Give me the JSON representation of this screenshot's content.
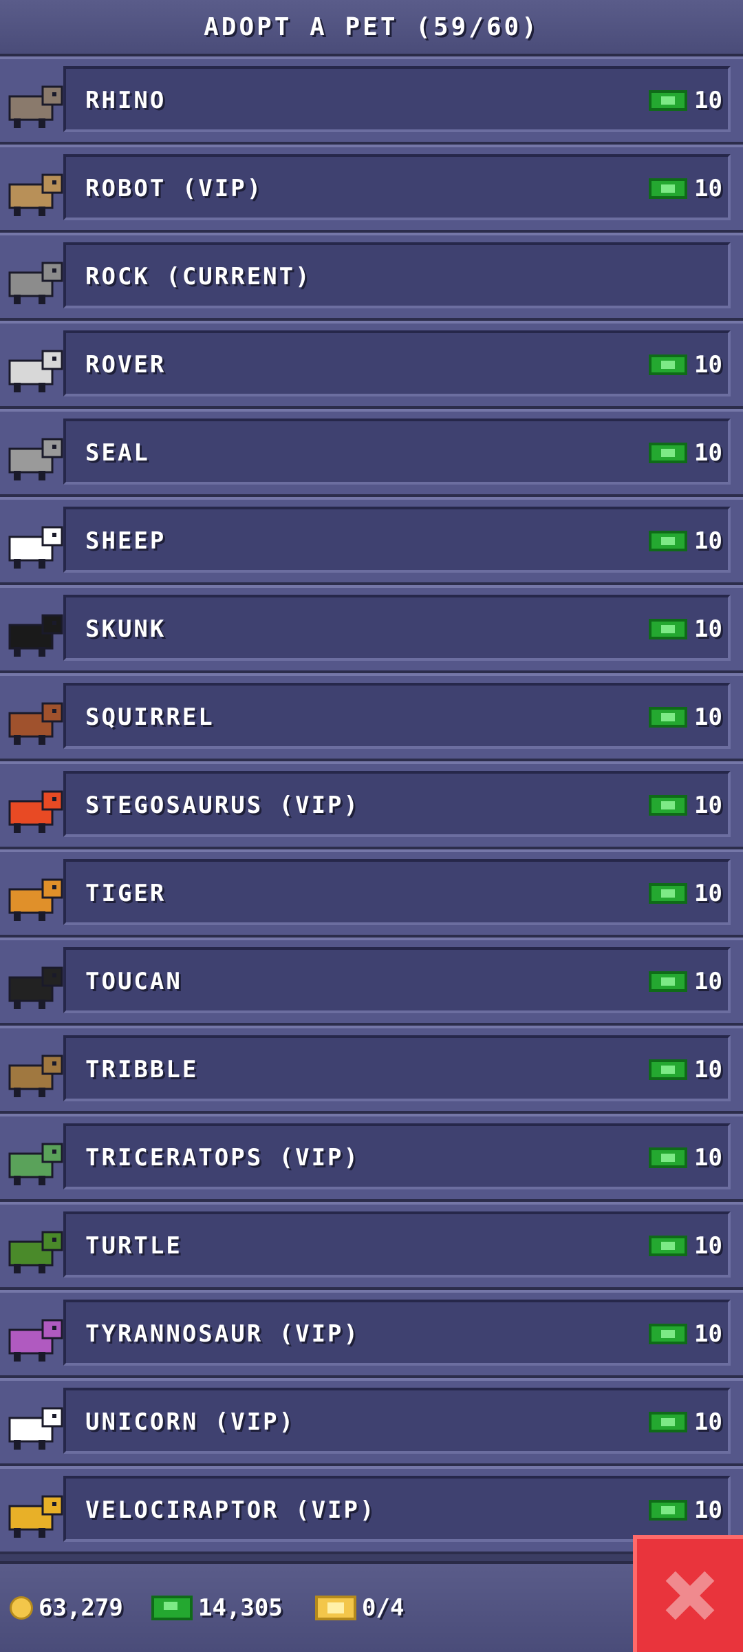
{
  "header": {
    "title": "ADOPT A PET (59/60)"
  },
  "pets": [
    {
      "name": "RHINO",
      "price": "10",
      "icon": "rhino-icon",
      "color": "#8a7a6c"
    },
    {
      "name": "ROBOT (VIP)",
      "price": "10",
      "icon": "robot-icon",
      "color": "#b89058"
    },
    {
      "name": "ROCK (CURRENT)",
      "price": "",
      "icon": "rock-icon",
      "color": "#8c8c8c"
    },
    {
      "name": "ROVER",
      "price": "10",
      "icon": "rover-icon",
      "color": "#d8d8d8"
    },
    {
      "name": "SEAL",
      "price": "10",
      "icon": "seal-icon",
      "color": "#9a9a9a"
    },
    {
      "name": "SHEEP",
      "price": "10",
      "icon": "sheep-icon",
      "color": "#ffffff"
    },
    {
      "name": "SKUNK",
      "price": "10",
      "icon": "skunk-icon",
      "color": "#1a1a1a"
    },
    {
      "name": "SQUIRREL",
      "price": "10",
      "icon": "squirrel-icon",
      "color": "#a0522d"
    },
    {
      "name": "STEGOSAURUS (VIP)",
      "price": "10",
      "icon": "stegosaurus-icon",
      "color": "#e84a24"
    },
    {
      "name": "TIGER",
      "price": "10",
      "icon": "tiger-icon",
      "color": "#e0902a"
    },
    {
      "name": "TOUCAN",
      "price": "10",
      "icon": "toucan-icon",
      "color": "#222222"
    },
    {
      "name": "TRIBBLE",
      "price": "10",
      "icon": "tribble-icon",
      "color": "#a07840"
    },
    {
      "name": "TRICERATOPS (VIP)",
      "price": "10",
      "icon": "triceratops-icon",
      "color": "#5aa25a"
    },
    {
      "name": "TURTLE",
      "price": "10",
      "icon": "turtle-icon",
      "color": "#4a8a2a"
    },
    {
      "name": "TYRANNOSAUR (VIP)",
      "price": "10",
      "icon": "tyrannosaur-icon",
      "color": "#b05ac0"
    },
    {
      "name": "UNICORN (VIP)",
      "price": "10",
      "icon": "unicorn-icon",
      "color": "#ffffff"
    },
    {
      "name": "VELOCIRAPTOR (VIP)",
      "price": "10",
      "icon": "velociraptor-icon",
      "color": "#e8b028"
    }
  ],
  "footer": {
    "coins": "63,279",
    "cash": "14,305",
    "tickets": "0/4"
  },
  "close_icon": "close-x-icon",
  "colors": {
    "close": "#e9343c",
    "cash": "#24a830",
    "coin": "#f3c64a"
  }
}
